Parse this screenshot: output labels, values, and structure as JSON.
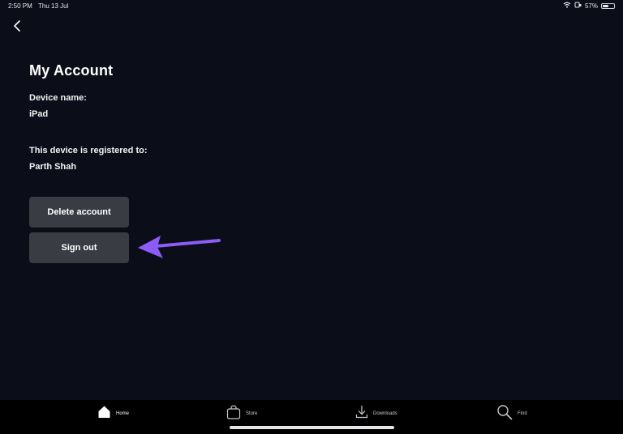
{
  "status_bar": {
    "time": "2:50 PM",
    "date": "Thu 13 Jul",
    "battery_percent": "57%",
    "battery_level": 0.57
  },
  "header": {
    "back_icon": "chevron-left-icon",
    "title": "My Account"
  },
  "account": {
    "device_name_label": "Device name:",
    "device_name_value": "iPad",
    "registered_label": "This device is registered to:",
    "registered_value": "Parth Shah"
  },
  "actions": {
    "delete_label": "Delete account",
    "signout_label": "Sign out"
  },
  "annotation": {
    "arrow_color": "#8b5cf6"
  },
  "tab_bar": {
    "tabs": [
      {
        "label": "Home",
        "icon": "home-icon",
        "active": true
      },
      {
        "label": "Store",
        "icon": "shopping-bag-icon",
        "active": false
      },
      {
        "label": "Downloads",
        "icon": "download-icon",
        "active": false
      },
      {
        "label": "Find",
        "icon": "search-icon",
        "active": false
      }
    ]
  }
}
